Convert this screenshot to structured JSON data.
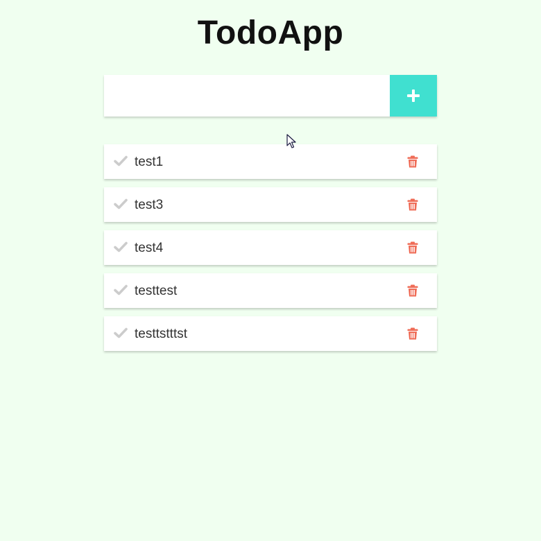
{
  "app": {
    "title": "TodoApp"
  },
  "new_todo": {
    "value": "",
    "placeholder": "",
    "add_icon": "plus-icon"
  },
  "todos": [
    {
      "text": "test1",
      "done": false
    },
    {
      "text": "test3",
      "done": false
    },
    {
      "text": "test4",
      "done": false
    },
    {
      "text": "testtest",
      "done": false
    },
    {
      "text": "testtstttst",
      "done": false
    }
  ],
  "colors": {
    "background": "#f0fff0",
    "accent": "#40e0d0",
    "delete": "#ef6c57",
    "check_inactive": "#cccccc"
  },
  "icons": {
    "check": "check-icon",
    "delete": "trash-icon"
  }
}
